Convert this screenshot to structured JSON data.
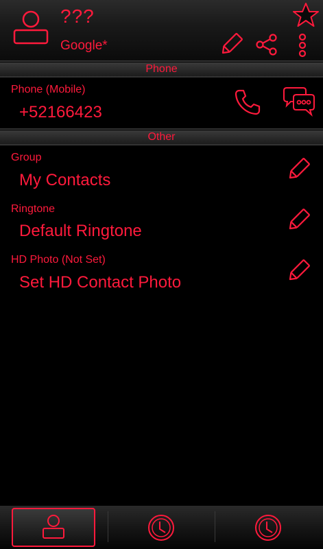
{
  "header": {
    "contact_name": "???",
    "account": "Google*"
  },
  "sections": {
    "phone": "Phone",
    "other": "Other"
  },
  "phone": {
    "label": "Phone  (Mobile)",
    "number": "+52166423"
  },
  "group": {
    "label": "Group",
    "value": "My Contacts"
  },
  "ringtone": {
    "label": "Ringtone",
    "value": "Default Ringtone"
  },
  "hd_photo": {
    "label": "HD Photo (Not Set)",
    "value": "Set HD Contact Photo"
  },
  "colors": {
    "accent": "#ff1a3c",
    "background": "#000000"
  },
  "icons": [
    "avatar-icon",
    "star-icon",
    "pencil-icon",
    "share-icon",
    "more-vert-icon",
    "phone-call-icon",
    "chat-bubbles-icon",
    "clock-icon"
  ]
}
